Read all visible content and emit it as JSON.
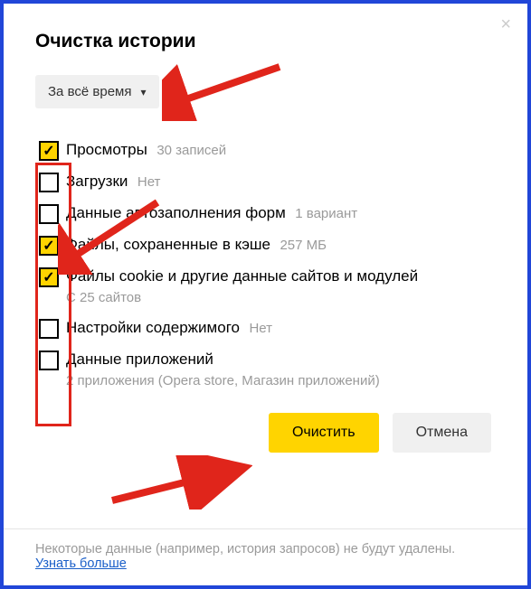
{
  "dialog": {
    "title": "Очистка истории",
    "timeRange": "За всё время",
    "options": [
      {
        "label": "Просмотры",
        "sub": "30 записей",
        "subInline": true,
        "checked": true
      },
      {
        "label": "Загрузки",
        "sub": "Нет",
        "subInline": true,
        "checked": false
      },
      {
        "label": "Данные автозаполнения форм",
        "sub": "1 вариант",
        "subInline": true,
        "checked": false
      },
      {
        "label": "Файлы, сохраненные в кэше",
        "sub": "257 МБ",
        "subInline": true,
        "checked": true
      },
      {
        "label": "Файлы cookie и другие данные сайтов и модулей",
        "sub": "С 25 сайтов",
        "subInline": false,
        "checked": true
      },
      {
        "label": "Настройки содержимого",
        "sub": "Нет",
        "subInline": true,
        "checked": false
      },
      {
        "label": "Данные приложений",
        "sub": "2 приложения (Opera store, Магазин приложений)",
        "subInline": false,
        "checked": false
      }
    ],
    "buttons": {
      "clear": "Очистить",
      "cancel": "Отмена"
    },
    "footer": {
      "text": "Некоторые данные (например, история запросов) не будут удалены.",
      "link": "Узнать больше"
    }
  }
}
